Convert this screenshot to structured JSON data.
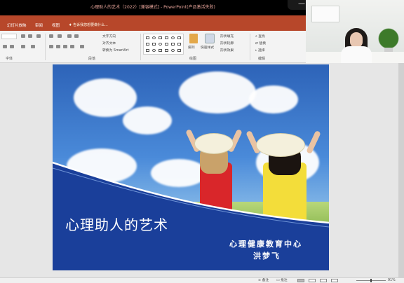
{
  "window": {
    "title": "心理助人的艺术（2022）[兼容模式] - PowerPoint(产品激活失败)",
    "minimize_icon": "minimize-icon",
    "maximize_icon": "maximize-icon",
    "more_icon": "more-icon"
  },
  "ribbon": {
    "tabs": [
      "幻灯片放映",
      "审阅",
      "视图"
    ],
    "tell_me": "告诉我您想要做什么...",
    "groups": [
      "字体",
      "段落",
      "绘图",
      "编辑"
    ],
    "paragraph": {
      "text_direction": "文字方向",
      "align_text": "对齐文本",
      "convert_smartart": "转换为 SmartArt"
    },
    "drawing": {
      "arrange": "排列",
      "quick_styles": "快速样式",
      "shape_fill": "形状填充",
      "shape_outline": "形状轮廓",
      "shape_effects": "形状效果"
    },
    "editing": {
      "find": "查找",
      "replace": "替换",
      "select": "选择"
    }
  },
  "slide": {
    "title": "心理助人的艺术",
    "org": "心理健康教育中心",
    "author": "洪梦飞"
  },
  "statusbar": {
    "notes": "备注",
    "comments": "批注",
    "zoom": "91%"
  },
  "colors": {
    "ribbon_accent": "#b7472a",
    "slide_blue": "#1a3f9a"
  }
}
